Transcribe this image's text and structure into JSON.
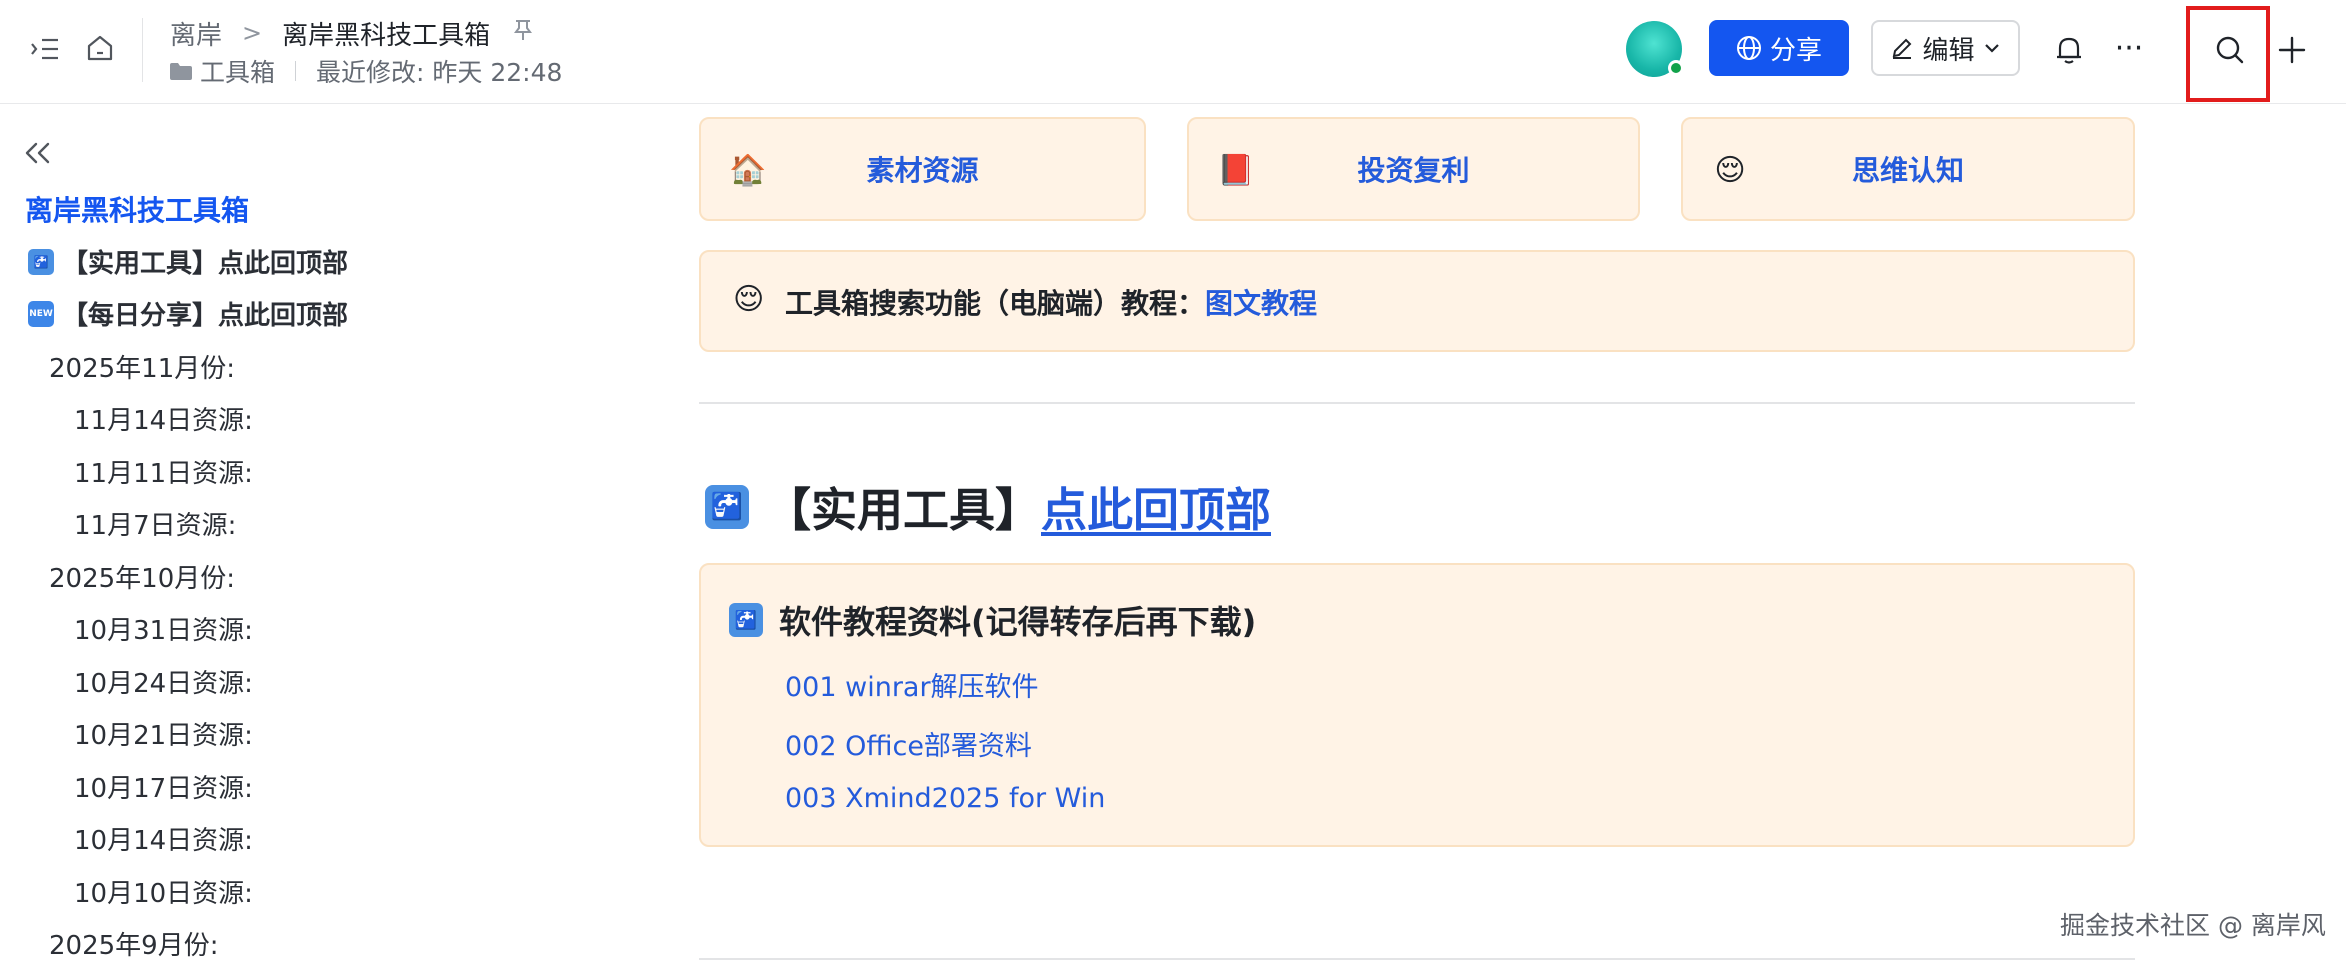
{
  "header": {
    "breadcrumb_parent": "离岸",
    "breadcrumb_sep": ">",
    "breadcrumb_current": "离岸黑科技工具箱",
    "folder": "工具箱",
    "last_modified": "最近修改: 昨天 22:48",
    "share_label": "分享",
    "edit_label": "编辑",
    "more_label": "···"
  },
  "sidebar": {
    "title": "离岸黑科技工具箱",
    "items": [
      {
        "label": "【实用工具】点此回顶部",
        "icon": "tool-icon"
      },
      {
        "label": "【每日分享】点此回顶部",
        "icon": "new-icon"
      },
      {
        "label": "2025年11月份:"
      },
      {
        "label": "11月14日资源:"
      },
      {
        "label": "11月11日资源:"
      },
      {
        "label": "11月7日资源:"
      },
      {
        "label": "2025年10月份:"
      },
      {
        "label": "10月31日资源:"
      },
      {
        "label": "10月24日资源:"
      },
      {
        "label": "10月21日资源:"
      },
      {
        "label": "10月17日资源:"
      },
      {
        "label": "10月14日资源:"
      },
      {
        "label": "10月10日资源:"
      },
      {
        "label": "2025年9月份:"
      }
    ]
  },
  "main": {
    "cards": [
      {
        "label": "素材资源",
        "icon": "house-icon"
      },
      {
        "label": "投资复利",
        "icon": "book-icon"
      },
      {
        "label": "思维认知",
        "icon": "face-icon"
      }
    ],
    "hint_text": "工具箱搜索功能（电脑端）教程：",
    "hint_link": "图文教程",
    "heading_text": "【实用工具】",
    "heading_link": "点此回顶部",
    "section_title": "软件教程资料(记得转存后再下载)",
    "links": [
      "001 winrar解压软件",
      "002 Office部署资料",
      "003 Xmind2025 for Win"
    ]
  },
  "watermark": "掘金技术社区 @ 离岸风",
  "colors": {
    "accent": "#1456f0",
    "link": "#245bdb",
    "card_bg": "#fff3e6",
    "highlight_box": "#e21c1c"
  }
}
